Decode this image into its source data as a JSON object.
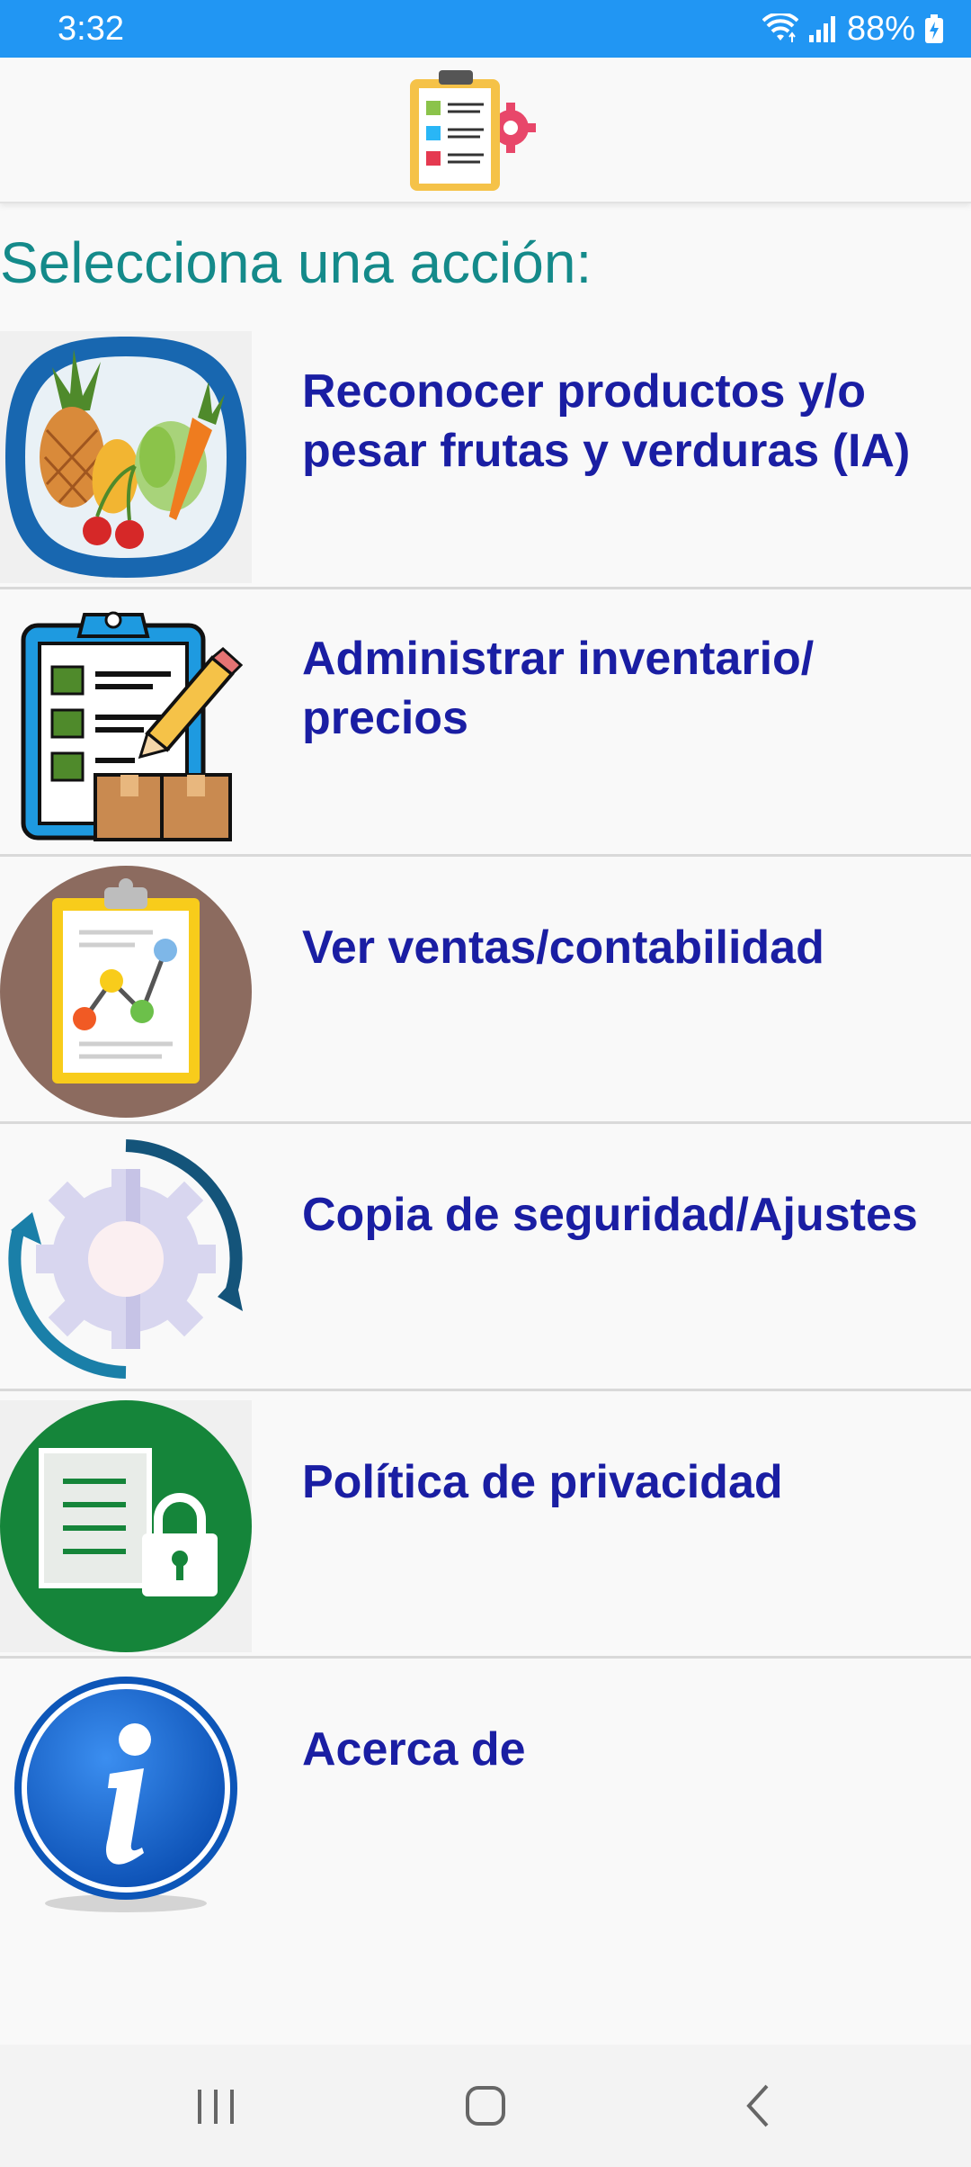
{
  "status_bar": {
    "time": "3:32",
    "battery": "88%",
    "icons": [
      "wifi-icon",
      "signal-icon",
      "battery-charging-icon"
    ]
  },
  "app_bar": {
    "logo_icon": "checklist-gear-icon"
  },
  "heading": "Selecciona una acción:",
  "menu": {
    "items": [
      {
        "label": "Reconocer productos y/o pesar frutas y verduras (IA)",
        "icon": "fruits-vegetables-icon"
      },
      {
        "label": "Administrar inventario/ precios",
        "icon": "inventory-clipboard-icon"
      },
      {
        "label": "Ver ventas/contabilidad",
        "icon": "sales-chart-icon"
      },
      {
        "label": "Copia de seguridad/Ajustes",
        "icon": "backup-settings-icon"
      },
      {
        "label": "Política de privacidad",
        "icon": "privacy-lock-icon"
      },
      {
        "label": "Acerca de",
        "icon": "info-icon"
      }
    ]
  },
  "nav_bar": {
    "buttons": [
      "recents-button",
      "home-button",
      "back-button"
    ]
  },
  "colors": {
    "status_bar": "#2196f3",
    "heading": "#148a8a",
    "menu_text": "#1a1ea3",
    "background": "#f9f9f9"
  }
}
